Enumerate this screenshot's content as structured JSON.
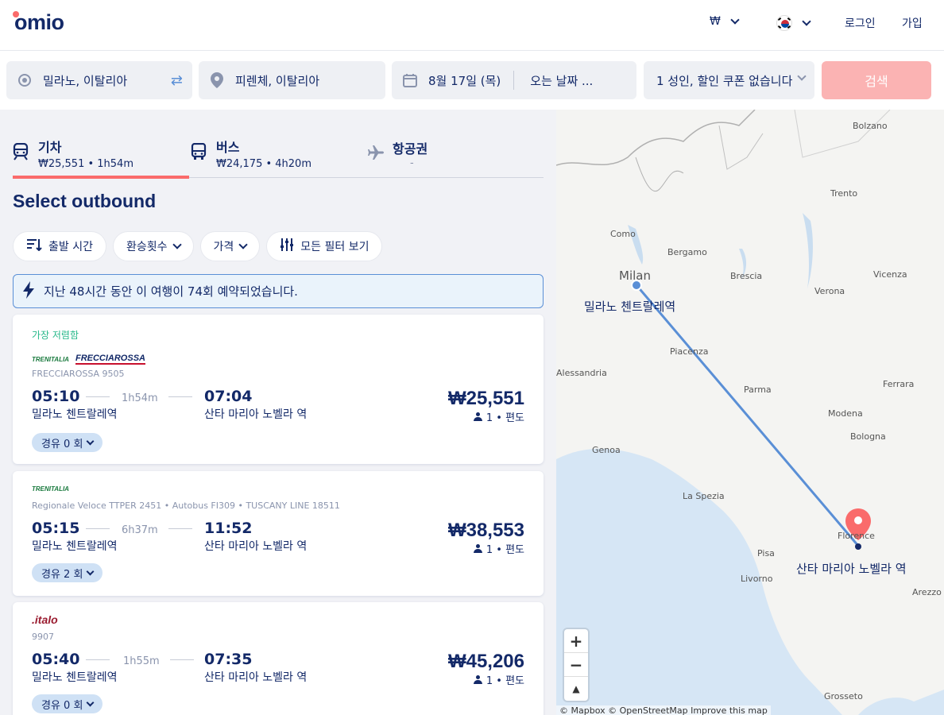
{
  "header": {
    "logo": "omio",
    "currency": "₩",
    "login": "로그인",
    "signup": "가입"
  },
  "search": {
    "origin": "밀라노, 이탈리아",
    "destination": "피렌체, 이탈리아",
    "date": "8월 17일 (목)",
    "return_placeholder": "오는 날짜 ...",
    "passengers": "1 성인, 할인 쿠폰 없습니다",
    "button": "검색"
  },
  "tabs": [
    {
      "label": "기차",
      "sub": "₩25,551 • 1h54m"
    },
    {
      "label": "버스",
      "sub": "₩24,175 • 4h20m"
    },
    {
      "label": "항공권",
      "sub": "-"
    }
  ],
  "section_title": "Select outbound",
  "filters": [
    "출발 시간",
    "환승횟수",
    "가격",
    "모든 필터 보기"
  ],
  "notice": "지난 48시간 동안 이 여행이 74회 예약되었습니다.",
  "results": [
    {
      "badge": "가장 저렴함",
      "logo1": "TRENITALIA",
      "logo2": "FRECCIAROSSA",
      "train": "FRECCIAROSSA 9505",
      "dep": "05:10",
      "dur": "1h54m",
      "arr": "07:04",
      "from": "밀라노 첸트랄레역",
      "to": "산타 마리아 노벨라 역",
      "price": "₩25,551",
      "pax": "1 • 편도",
      "stops": "경유 0 회"
    },
    {
      "badge": "",
      "logo1": "TRENITALIA",
      "logo2": "",
      "train": "Regionale Veloce TTPER 2451 • Autobus FI309 • TUSCANY LINE 18511",
      "dep": "05:15",
      "dur": "6h37m",
      "arr": "11:52",
      "from": "밀라노 첸트랄레역",
      "to": "산타 마리아 노벨라 역",
      "price": "₩38,553",
      "pax": "1 • 편도",
      "stops": "경유 2 회"
    },
    {
      "badge": "",
      "logo1": ".italo",
      "logo2": "",
      "train": "9907",
      "dep": "05:40",
      "dur": "1h55m",
      "arr": "07:35",
      "from": "밀라노 첸트랄레역",
      "to": "산타 마리아 노벨라 역",
      "price": "₩45,206",
      "pax": "1 • 편도",
      "stops": "경유 0 회"
    }
  ],
  "map": {
    "cities": [
      "Bolzano",
      "Trento",
      "Como",
      "Bergamo",
      "Milan",
      "Brescia",
      "Verona",
      "Vicenza",
      "Piacenza",
      "Alessandria",
      "Parma",
      "Ferrara",
      "Modena",
      "Bologna",
      "Genoa",
      "La Spezia",
      "Florence",
      "Pisa",
      "Livorno",
      "Arezzo",
      "Grosseto"
    ],
    "origin_station": "밀라노 첸트랄레역",
    "dest_station": "산타 마리아 노벨라 역",
    "attribution": "© Mapbox © OpenStreetMap Improve this map",
    "route_color": "#5a8fd6",
    "pin_color": "#fa6b6b"
  }
}
